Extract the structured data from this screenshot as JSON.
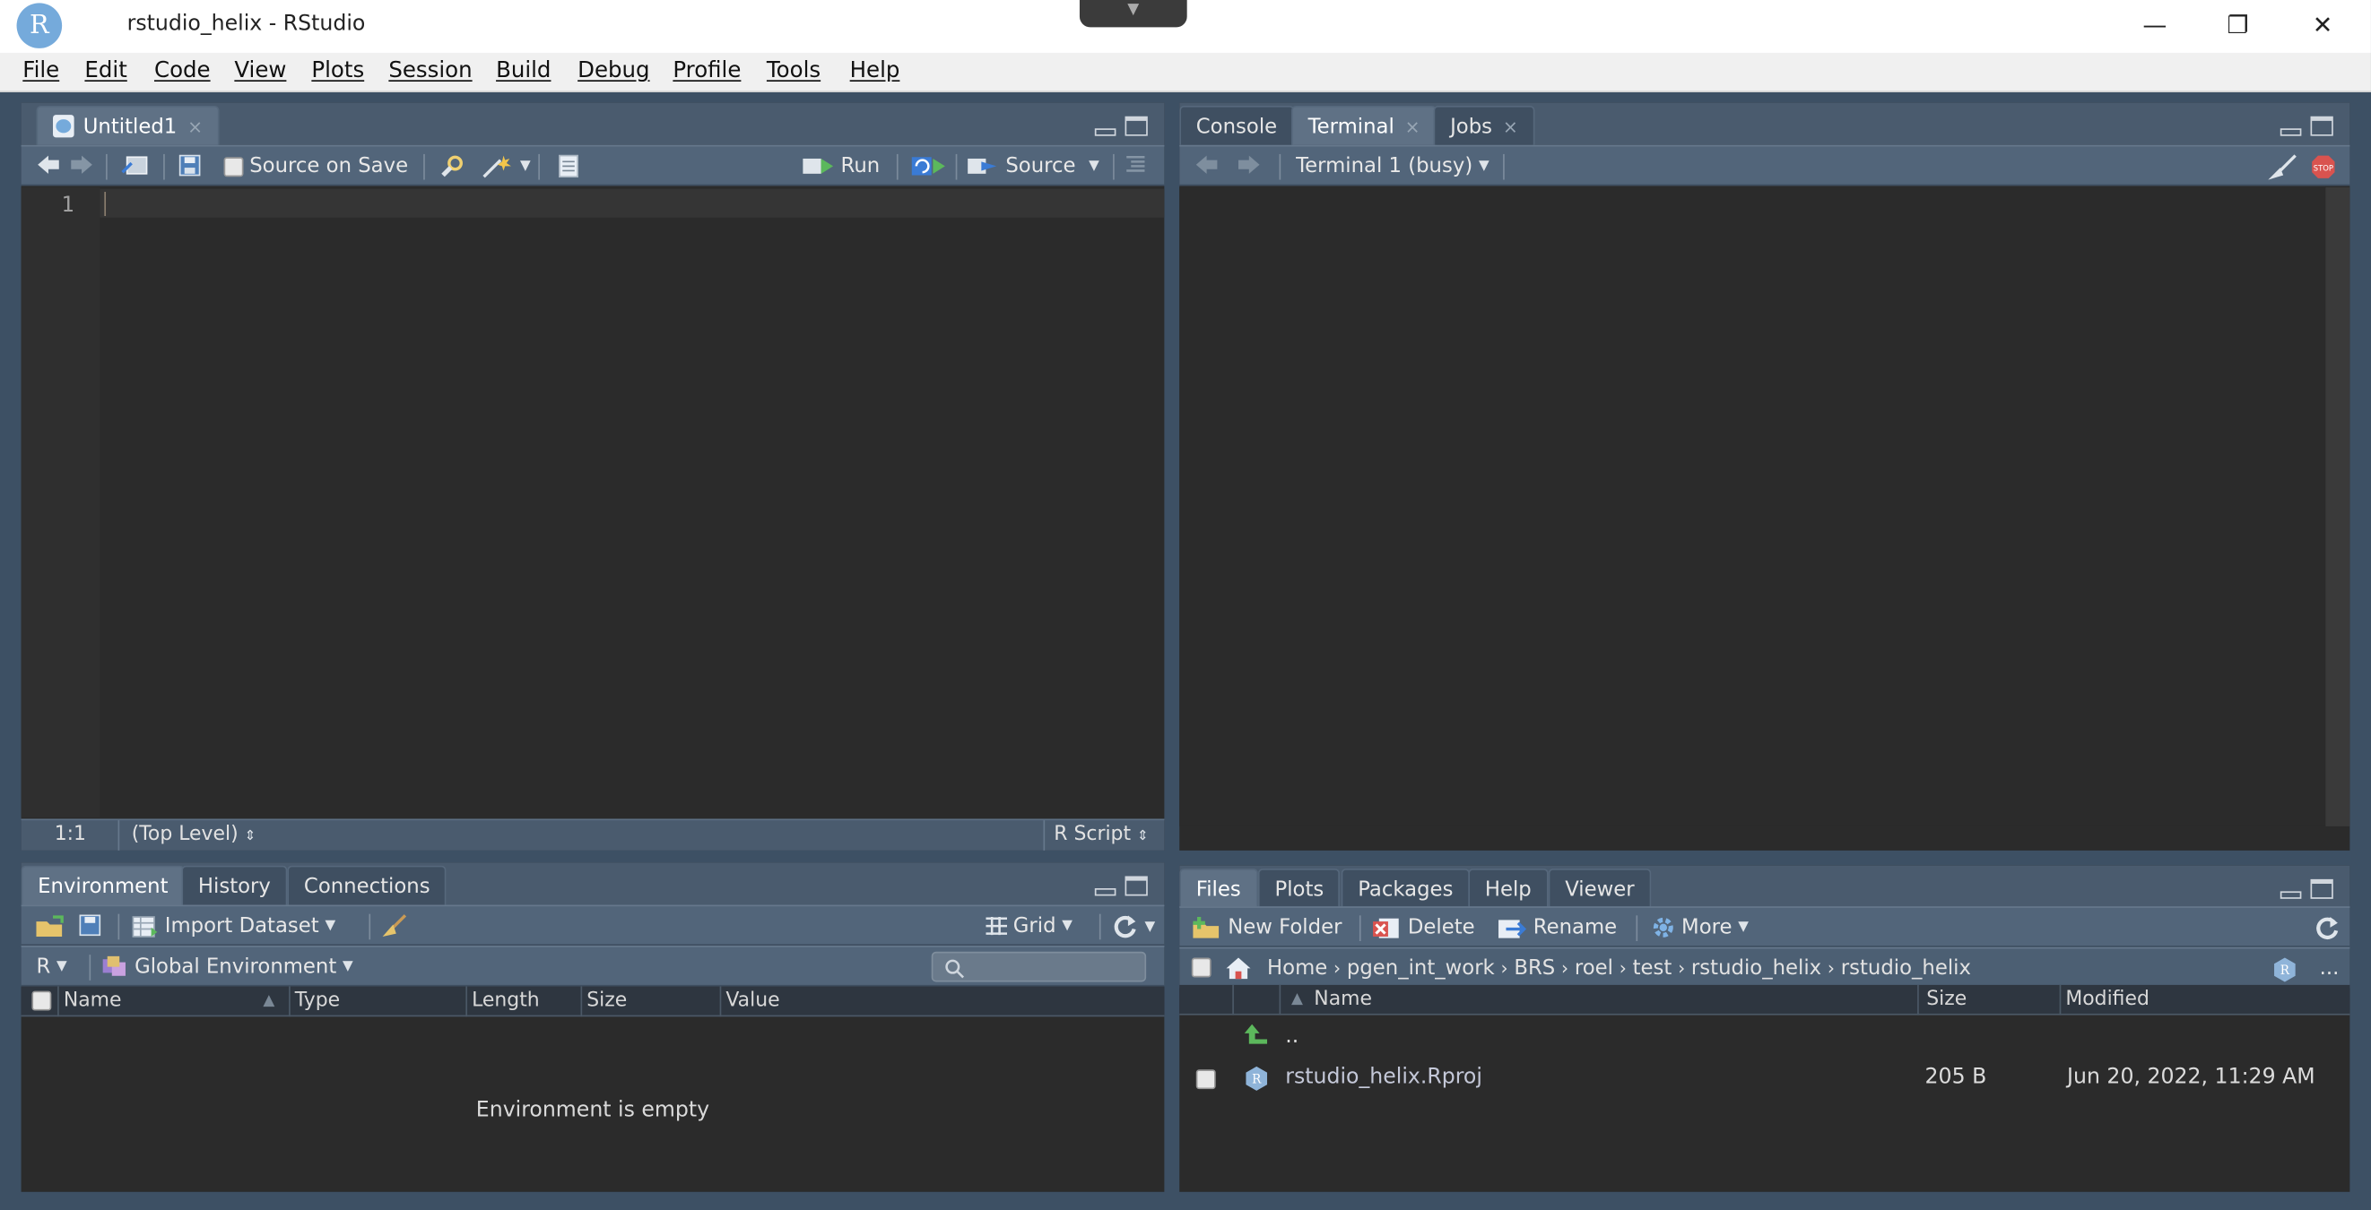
{
  "window": {
    "title": "rstudio_helix - RStudio",
    "logo_letter": "R",
    "dropdown_glyph": "▼",
    "minimize_glyph": "—",
    "restore_glyph": "❐",
    "close_glyph": "✕"
  },
  "menu": [
    "File",
    "Edit",
    "Code",
    "View",
    "Plots",
    "Session",
    "Build",
    "Debug",
    "Profile",
    "Tools",
    "Help"
  ],
  "editor": {
    "tab_label": "Untitled1",
    "tab_close": "×",
    "source_on_save": "Source on Save",
    "run_label": "Run",
    "source_label": "Source",
    "line_number": "1",
    "status": {
      "position": "1:1",
      "scope": "(Top Level)",
      "file_type": "R Script"
    }
  },
  "console": {
    "tabs": [
      "Console",
      "Terminal",
      "Jobs"
    ],
    "active_tab": "Terminal",
    "tab_close": "×",
    "terminal_selector": "Terminal 1 (busy)",
    "stop_label": "STOP"
  },
  "environment": {
    "tabs": [
      "Environment",
      "History",
      "Connections"
    ],
    "import_dataset": "Import Dataset",
    "grid_label": "Grid",
    "lang": "R",
    "scope": "Global Environment",
    "columns": [
      "Name",
      "Type",
      "Length",
      "Size",
      "Value"
    ],
    "empty_message": "Environment is empty"
  },
  "files": {
    "tabs": [
      "Files",
      "Plots",
      "Packages",
      "Help",
      "Viewer"
    ],
    "new_folder": "New Folder",
    "delete": "Delete",
    "rename": "Rename",
    "more": "More",
    "breadcrumb": [
      "Home",
      "pgen_int_work",
      "BRS",
      "roel",
      "test",
      "rstudio_helix",
      "rstudio_helix"
    ],
    "ellipsis": "...",
    "columns": [
      "Name",
      "Size",
      "Modified"
    ],
    "parent_dir": "..",
    "rows": [
      {
        "name": "rstudio_helix.Rproj",
        "size": "205 B",
        "modified": "Jun 20, 2022, 11:29 AM"
      }
    ]
  },
  "colors": {
    "frame": "#3d5064",
    "toolbar": "#52657a",
    "pane_bg": "#2b2b2b",
    "accent_green": "#5cb85c",
    "stop_red": "#d9534f"
  }
}
